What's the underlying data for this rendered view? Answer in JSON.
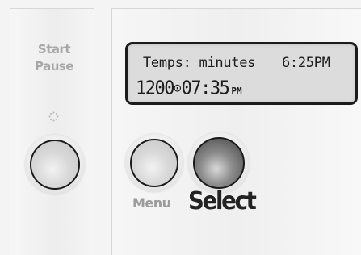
{
  "left_panel": {
    "start_label": "Start",
    "pause_label": "Pause",
    "indicator": "dotted-spinner-icon"
  },
  "display": {
    "line1_text": "Temps: minutes",
    "line1_clock": "6:25PM",
    "line2_prefix": "1200",
    "line2_cycle_icon": "⊙",
    "line2_time": "07:35",
    "line2_ampm": "PM"
  },
  "controls": {
    "menu_label": "Menu",
    "select_label": "Select"
  },
  "colors": {
    "label_gray": "#9c9c9c",
    "select_black": "#222222",
    "lcd_background": "#dcdcdc"
  }
}
